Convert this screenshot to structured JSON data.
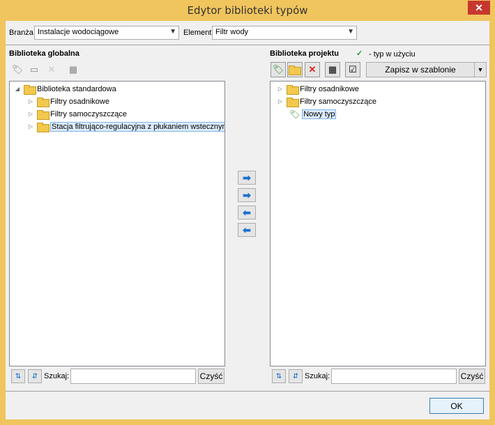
{
  "window": {
    "title": "Edytor biblioteki typów",
    "close": "✕"
  },
  "filters": {
    "branza_label": "Branża",
    "branza_value": "Instalacje wodociągowe",
    "element_label": "Element",
    "element_value": "Filtr wody"
  },
  "left": {
    "heading": "Biblioteka globalna",
    "tree": [
      {
        "label": "Biblioteka standardowa",
        "expander": "◢"
      },
      {
        "label": "Filtry osadnikowe",
        "expander": "▷"
      },
      {
        "label": "Filtry samoczyszczące",
        "expander": "▷"
      },
      {
        "label": "Stacja filtrująco-regulacyjna z płukaniem wstecznym",
        "expander": "▷"
      }
    ],
    "search_label": "Szukaj:",
    "search_value": "",
    "clear_label": "Czyść"
  },
  "right": {
    "heading": "Biblioteka projektu",
    "legend_check": "✓",
    "legend_text": "- typ w użyciu",
    "save_template_label": "Zapisz w szablonie",
    "tree": [
      {
        "label": "Filtry osadnikowe",
        "expander": "▷"
      },
      {
        "label": "Filtry samoczyszczące",
        "expander": "▷"
      },
      {
        "label": "Nowy typ"
      }
    ],
    "search_label": "Szukaj:",
    "search_value": "",
    "clear_label": "Czyść"
  },
  "transfer": {
    "copy_all_right": "➡",
    "copy_right": "➡",
    "copy_left": "⬅",
    "copy_all_left": "⬅"
  },
  "footer": {
    "ok_label": "OK"
  },
  "colors": {
    "frame": "#f0c55e",
    "close": "#c7372f",
    "selection": "#dcecfc"
  }
}
